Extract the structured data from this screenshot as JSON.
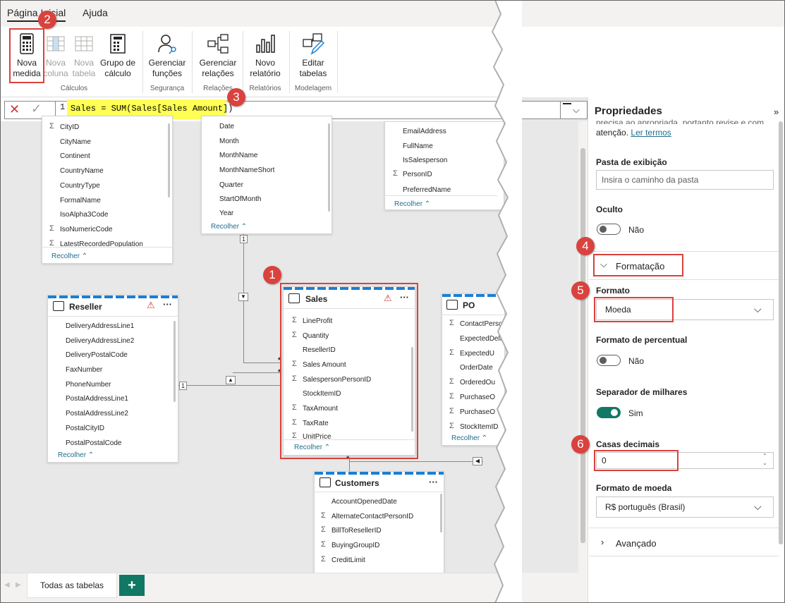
{
  "ribbon": {
    "tabs": [
      "Página Inicial",
      "Ajuda"
    ],
    "buttons": {
      "nova_medida": [
        "Nova",
        "medida"
      ],
      "nova_coluna": [
        "Nova",
        "coluna"
      ],
      "nova_tabela": [
        "Nova",
        "tabela"
      ],
      "grupo_calculo": [
        "Grupo de",
        "cálculo"
      ],
      "gerenciar_funcoes": [
        "Gerenciar",
        "funções"
      ],
      "gerenciar_relacoes": [
        "Gerenciar",
        "relações"
      ],
      "novo_relatorio": [
        "Novo",
        "relatório"
      ],
      "editar_tabelas": [
        "Editar",
        "tabelas"
      ]
    },
    "groups": {
      "calculos": "Cálculos",
      "seguranca": "Segurança",
      "relacoes": "Relações",
      "relatorios": "Relatórios",
      "modelagem": "Modelagem"
    }
  },
  "formula": {
    "line_number": "1",
    "text": "Sales = SUM(Sales[Sales Amount])"
  },
  "tables": {
    "city": {
      "fields": [
        "CityID",
        "CityName",
        "Continent",
        "CountryName",
        "CountryType",
        "FormalName",
        "IsoAlpha3Code",
        "IsoNumericCode",
        "LatestRecordedPopulation"
      ],
      "collapse": "Recolher"
    },
    "date": {
      "fields": [
        "Date",
        "Month",
        "MonthName",
        "MonthNameShort",
        "Quarter",
        "StartOfMonth",
        "Year"
      ],
      "collapse": "Recolher"
    },
    "person": {
      "fields": [
        "EmailAddress",
        "FullName",
        "IsSalesperson",
        "PersonID",
        "PreferredName"
      ],
      "collapse": "Recolher"
    },
    "reseller": {
      "title": "Reseller",
      "fields": [
        "DeliveryAddressLine1",
        "DeliveryAddressLine2",
        "DeliveryPostalCode",
        "FaxNumber",
        "PhoneNumber",
        "PostalAddressLine1",
        "PostalAddressLine2",
        "PostalCityID",
        "PostalPostalCode"
      ],
      "collapse": "Recolher"
    },
    "sales": {
      "title": "Sales",
      "fields": [
        "LineProfit",
        "Quantity",
        "ResellerID",
        "Sales Amount",
        "SalespersonPersonID",
        "StockItemID",
        "TaxAmount",
        "TaxRate",
        "UnitPrice"
      ],
      "collapse": "Recolher"
    },
    "po": {
      "title": "PO",
      "fields": [
        "ContactPerso",
        "ExpectedDeli",
        "ExpectedU",
        "OrderDate",
        "OrderedOu",
        "PurchaseO",
        "PurchaseO",
        "StockItemID"
      ],
      "collapse": "Recolher"
    },
    "customers": {
      "title": "Customers",
      "fields": [
        "AccountOpenedDate",
        "AlternateContactPersonID",
        "BillToResellerID",
        "BuyingGroupID",
        "CreditLimit"
      ]
    }
  },
  "relationships": {
    "one": "1",
    "many": "*"
  },
  "properties": {
    "title": "Propriedades",
    "intro": "precisa ao apropriada, portanto revise e com",
    "intro2": "atenção.",
    "link": "Ler termos",
    "folder_label": "Pasta de exibição",
    "folder_placeholder": "Insira o caminho da pasta",
    "hidden_label": "Oculto",
    "hidden_value": "Não",
    "formatting_section": "Formatação",
    "format_label": "Formato",
    "format_value": "Moeda",
    "percent_label": "Formato de percentual",
    "percent_value": "Não",
    "thousands_label": "Separador de milhares",
    "thousands_value": "Sim",
    "decimals_label": "Casas decimais",
    "decimals_value": "0",
    "currency_label": "Formato de moeda",
    "currency_value": "R$ português (Brasil)",
    "advanced_section": "Avançado"
  },
  "bottom": {
    "tab": "Todas as tabelas",
    "add": "+"
  },
  "annotations": [
    "1",
    "2",
    "3",
    "4",
    "5",
    "6"
  ],
  "colors": {
    "accent": "#117865",
    "highlight": "#ffff55",
    "annotation": "#d9423d",
    "stripe": "#1a7fd4"
  }
}
